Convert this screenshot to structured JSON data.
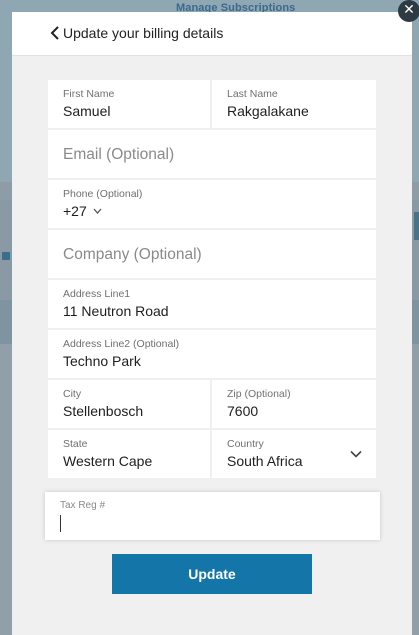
{
  "background": {
    "top_link": "Manage Subscriptions"
  },
  "header": {
    "title": "Update your billing details",
    "back_icon": "chevron-left-icon"
  },
  "close_icon": "close-icon",
  "form": {
    "first_name": {
      "label": "First Name",
      "value": "Samuel"
    },
    "last_name": {
      "label": "Last Name",
      "value": "Rakgalakane"
    },
    "email": {
      "placeholder": "Email (Optional)"
    },
    "phone": {
      "label": "Phone (Optional)",
      "code": "+27"
    },
    "company": {
      "placeholder": "Company (Optional)"
    },
    "address1": {
      "label": "Address Line1",
      "value": "11 Neutron Road"
    },
    "address2": {
      "label": "Address Line2 (Optional)",
      "value": "Techno Park"
    },
    "city": {
      "label": "City",
      "value": "Stellenbosch"
    },
    "zip": {
      "label": "Zip (Optional)",
      "value": "7600"
    },
    "state": {
      "label": "State",
      "value": "Western Cape"
    },
    "country": {
      "label": "Country",
      "value": "South Africa"
    },
    "tax": {
      "label": "Tax Reg #",
      "value": ""
    }
  },
  "update_button": "Update",
  "colors": {
    "primary": "#1475a8",
    "overlay": "#8a9aa4"
  }
}
